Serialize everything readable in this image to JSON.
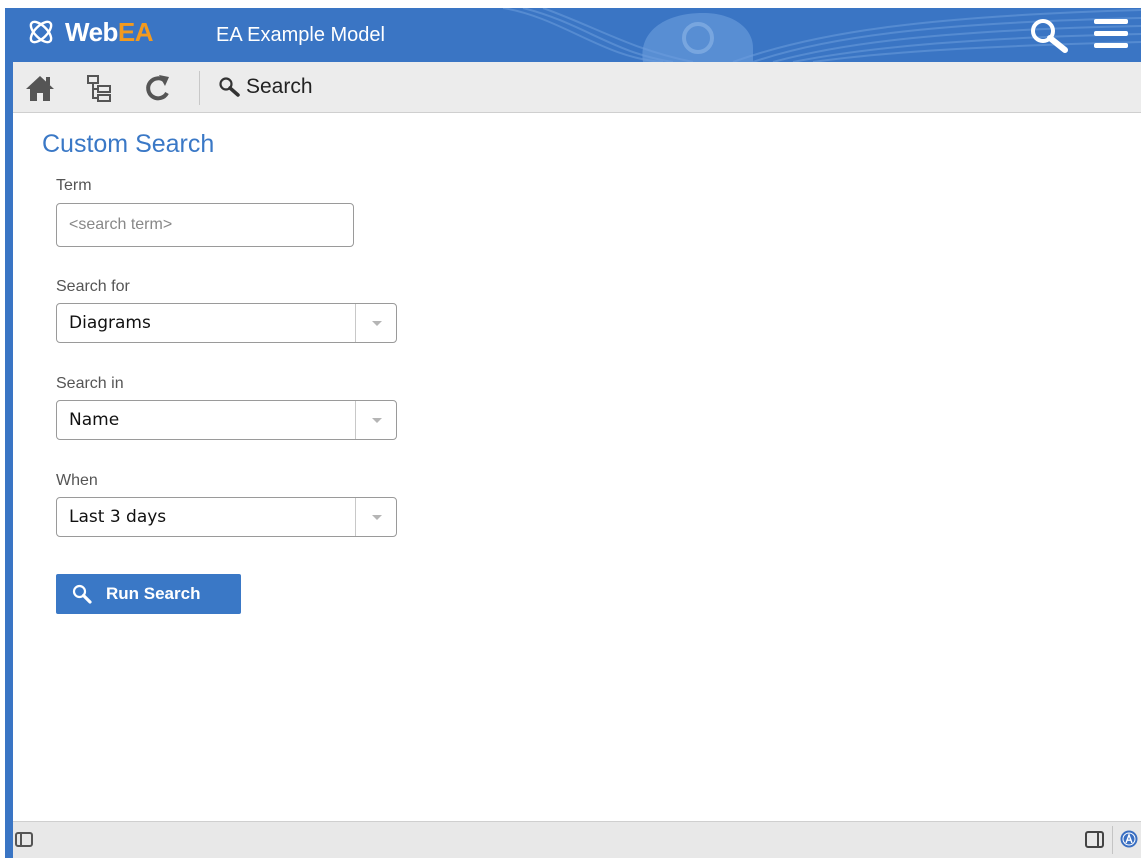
{
  "header": {
    "logo_web": "Web",
    "logo_ea": "EA",
    "model_name": "EA Example Model",
    "brand_color": "#3a75c4",
    "accent_color": "#f39a1e",
    "icons": [
      "webea-logo-icon",
      "header-search-icon",
      "hamburger-menu-icon"
    ]
  },
  "toolbar": {
    "icons": [
      "home-icon",
      "browser-tree-icon",
      "refresh-icon"
    ],
    "search_label": "Search"
  },
  "content": {
    "title": "Custom Search",
    "title_color": "#3a78c6",
    "term": {
      "label": "Term",
      "value": "",
      "placeholder": "<search term>"
    },
    "search_for": {
      "label": "Search for",
      "value": "Diagrams"
    },
    "search_in": {
      "label": "Search in",
      "value": "Name"
    },
    "when": {
      "label": "When",
      "value": "Last 3 days"
    },
    "run_button": {
      "label": "Run Search",
      "color": "#3a78c6"
    }
  },
  "statusbar": {
    "icons": [
      "toggle-left-panel-icon",
      "toggle-right-panel-icon",
      "user-avatar-icon"
    ]
  }
}
